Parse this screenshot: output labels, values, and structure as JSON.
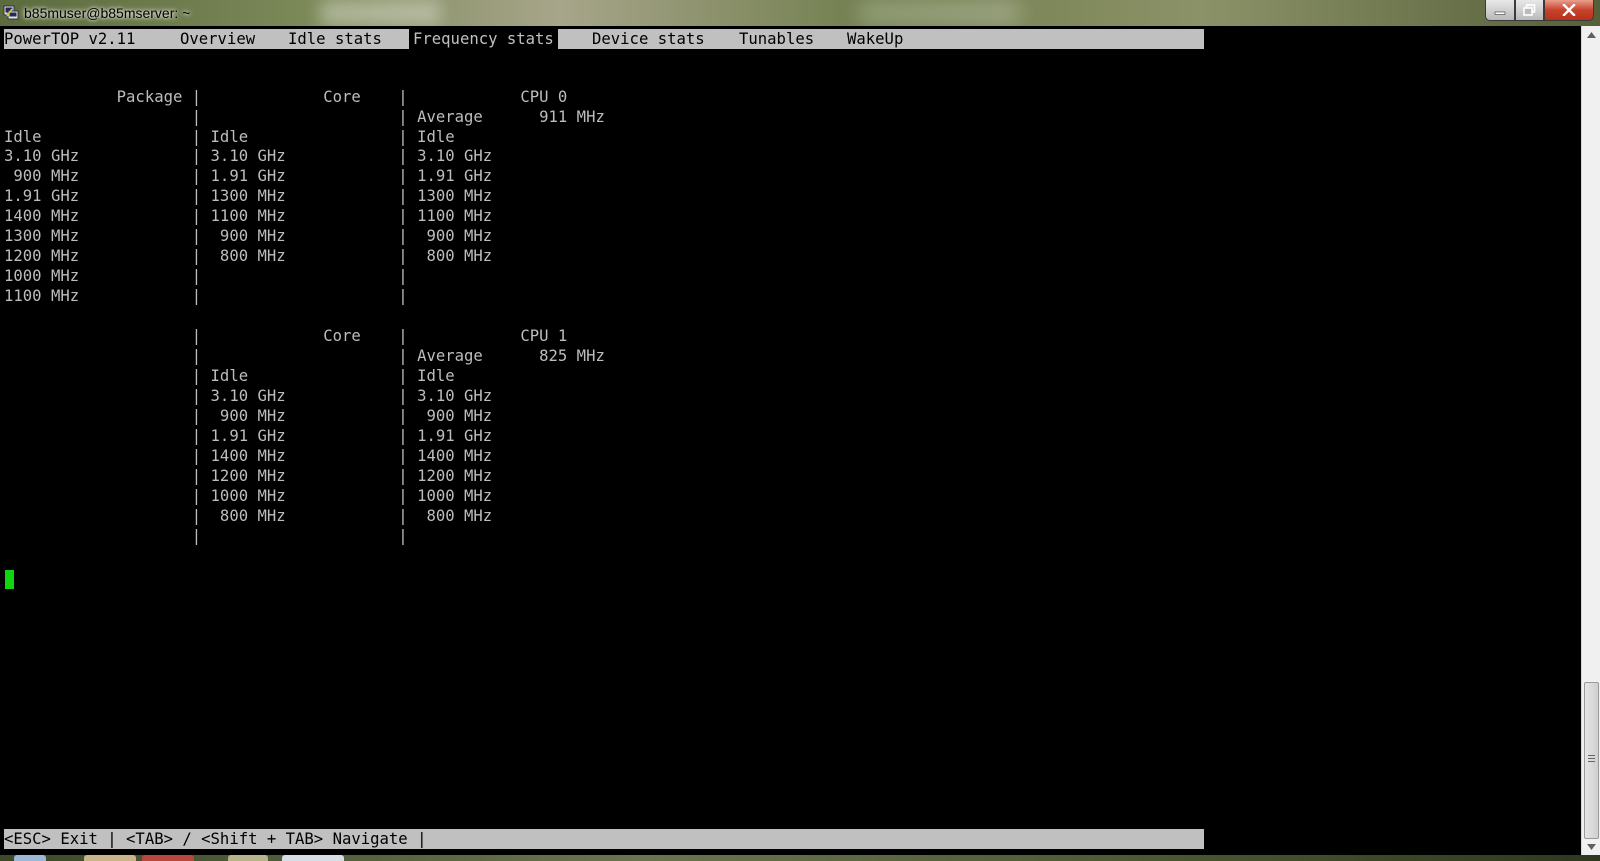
{
  "window": {
    "title": "b85muser@b85mserver: ~",
    "icons": {
      "app": "putty-terminal-icon",
      "minimize": "minimize-icon",
      "maximize": "restore-icon",
      "close": "close-icon"
    }
  },
  "menu": {
    "tabs": [
      {
        "label": "PowerTOP v2.11"
      },
      {
        "label": "Overview"
      },
      {
        "label": "Idle stats"
      },
      {
        "label": "Frequency stats",
        "active": true
      },
      {
        "label": "Device stats"
      },
      {
        "label": "Tunables"
      },
      {
        "label": "WakeUp"
      }
    ]
  },
  "screen": {
    "lines": [
      "",
      "",
      "            Package |             Core    |            CPU 0",
      "                    |                     | Average      911 MHz",
      "Idle                | Idle                | Idle",
      "3.10 GHz            | 3.10 GHz            | 3.10 GHz",
      " 900 MHz            | 1.91 GHz            | 1.91 GHz",
      "1.91 GHz            | 1300 MHz            | 1300 MHz",
      "1400 MHz            | 1100 MHz            | 1100 MHz",
      "1300 MHz            |  900 MHz            |  900 MHz",
      "1200 MHz            |  800 MHz            |  800 MHz",
      "1000 MHz            |                     |",
      "1100 MHz            |                     |",
      "",
      "                    |             Core    |            CPU 1",
      "                    |                     | Average      825 MHz",
      "                    | Idle                | Idle",
      "                    | 3.10 GHz            | 3.10 GHz",
      "                    |  900 MHz            |  900 MHz",
      "                    | 1.91 GHz            | 1.91 GHz",
      "                    | 1400 MHz            | 1400 MHz",
      "                    | 1200 MHz            | 1200 MHz",
      "                    | 1000 MHz            | 1000 MHz",
      "                    |  800 MHz            |  800 MHz",
      "                    |                     |"
    ]
  },
  "status": {
    "text": "<ESC> Exit | <TAB> / <Shift + TAB> Navigate |"
  },
  "colors": {
    "terminal_bg": "#000000",
    "terminal_fg": "#bdbdbd",
    "bar_bg": "#c0c0c0",
    "cursor": "#10d610"
  }
}
